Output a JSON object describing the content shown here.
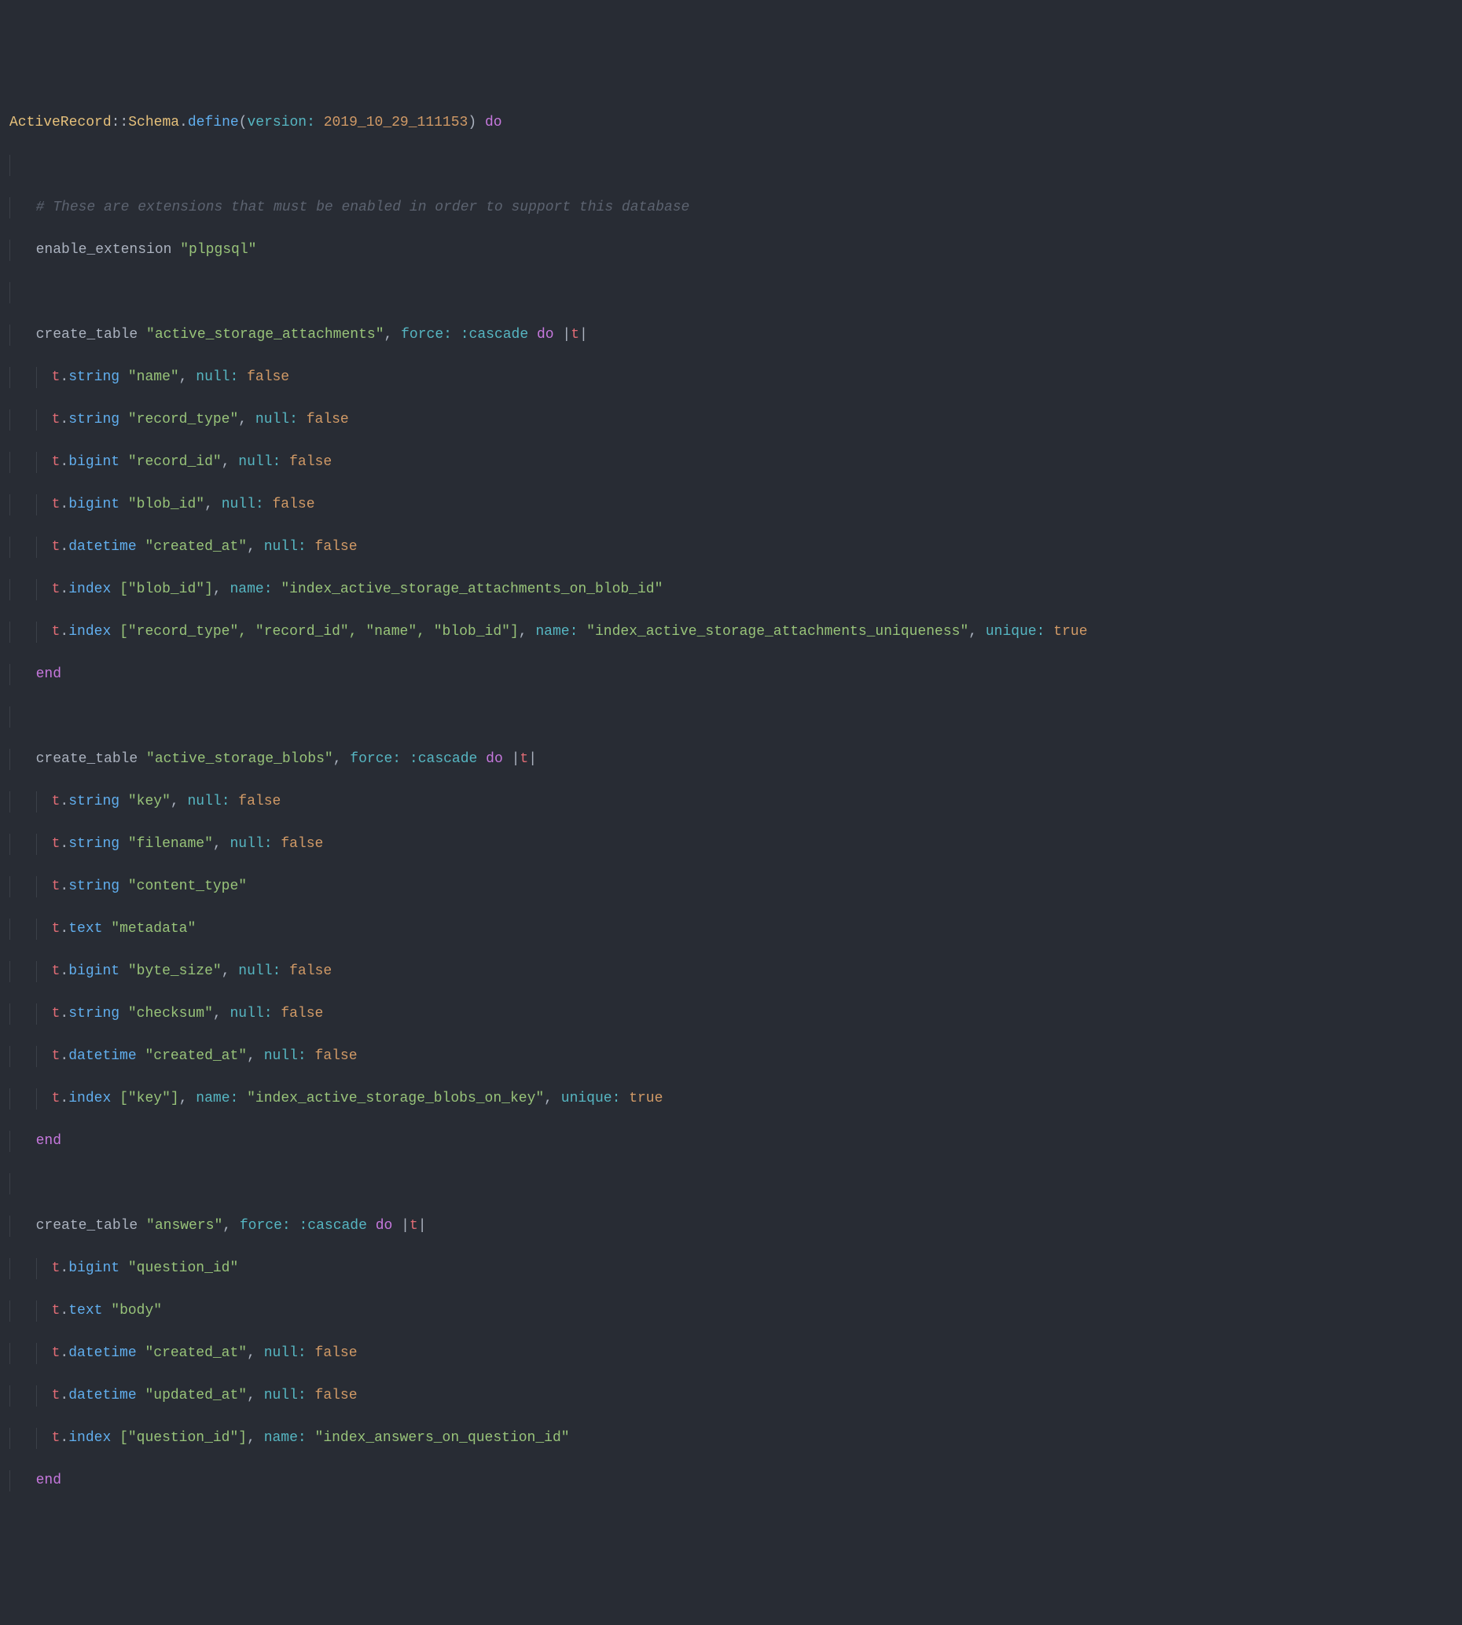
{
  "code": {
    "schema_class1": "ActiveRecord",
    "schema_class2": "Schema",
    "define": "define",
    "version_label": "version: ",
    "version_value": "2019_10_29_111153",
    "do": "do",
    "end": "end",
    "comment1": "# These are extensions that must be enabled in order to support this database",
    "enable_ext": "enable_extension ",
    "plpgsql": "\"plpgsql\"",
    "create_table": "create_table ",
    "force_label": "force: ",
    "cascade": ":cascade",
    "pipe_t": "|t|",
    "t": "t",
    "null_label": "null: ",
    "name_label": "name: ",
    "unique_label": "unique: ",
    "false": "false",
    "true": "true",
    "m_string": "string",
    "m_bigint": "bigint",
    "m_datetime": "datetime",
    "m_text": "text",
    "m_index": "index",
    "tbl1_name": "\"active_storage_attachments\"",
    "tbl1_c1": "\"name\"",
    "tbl1_c2": "\"record_type\"",
    "tbl1_c3": "\"record_id\"",
    "tbl1_c4": "\"blob_id\"",
    "tbl1_c5": "\"created_at\"",
    "tbl1_idx1_cols": "[\"blob_id\"]",
    "tbl1_idx1_name": "\"index_active_storage_attachments_on_blob_id\"",
    "tbl1_idx2_cols": "[\"record_type\", \"record_id\", \"name\", \"blob_id\"]",
    "tbl1_idx2_name": "\"index_active_storage_attachments_uniqueness\"",
    "tbl2_name": "\"active_storage_blobs\"",
    "tbl2_c1": "\"key\"",
    "tbl2_c2": "\"filename\"",
    "tbl2_c3": "\"content_type\"",
    "tbl2_c4": "\"metadata\"",
    "tbl2_c5": "\"byte_size\"",
    "tbl2_c6": "\"checksum\"",
    "tbl2_c7": "\"created_at\"",
    "tbl2_idx1_cols": "[\"key\"]",
    "tbl2_idx1_name": "\"index_active_storage_blobs_on_key\"",
    "tbl3_name": "\"answers\"",
    "tbl3_c1": "\"question_id\"",
    "tbl3_c2": "\"body\"",
    "tbl3_c3": "\"created_at\"",
    "tbl3_c4": "\"updated_at\"",
    "tbl3_idx1_cols": "[\"question_id\"]",
    "tbl3_idx1_name": "\"index_answers_on_question_id\""
  }
}
